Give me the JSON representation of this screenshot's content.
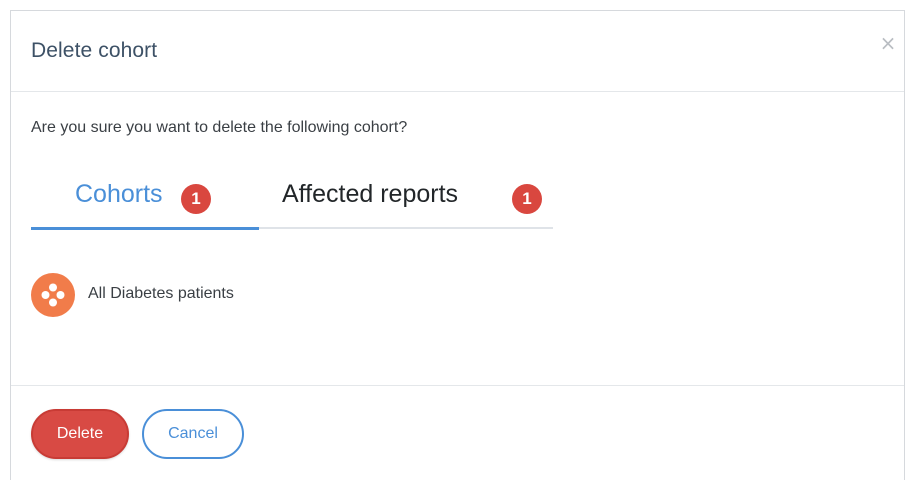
{
  "dialog": {
    "title": "Delete cohort",
    "close_symbol": "×",
    "question": "Are you sure you want to delete the following cohort?"
  },
  "tabs": [
    {
      "label": "Cohorts",
      "count": "1",
      "active": true
    },
    {
      "label": "Affected reports",
      "count": "1",
      "active": false
    }
  ],
  "cohorts": [
    {
      "name": "All Diabetes patients",
      "icon": "cohort-dots-icon",
      "icon_color": "#f17c4a"
    }
  ],
  "footer": {
    "delete_label": "Delete",
    "cancel_label": "Cancel"
  },
  "colors": {
    "accent": "#4a8fd8",
    "danger": "#d84a44",
    "title": "#3d5166"
  }
}
